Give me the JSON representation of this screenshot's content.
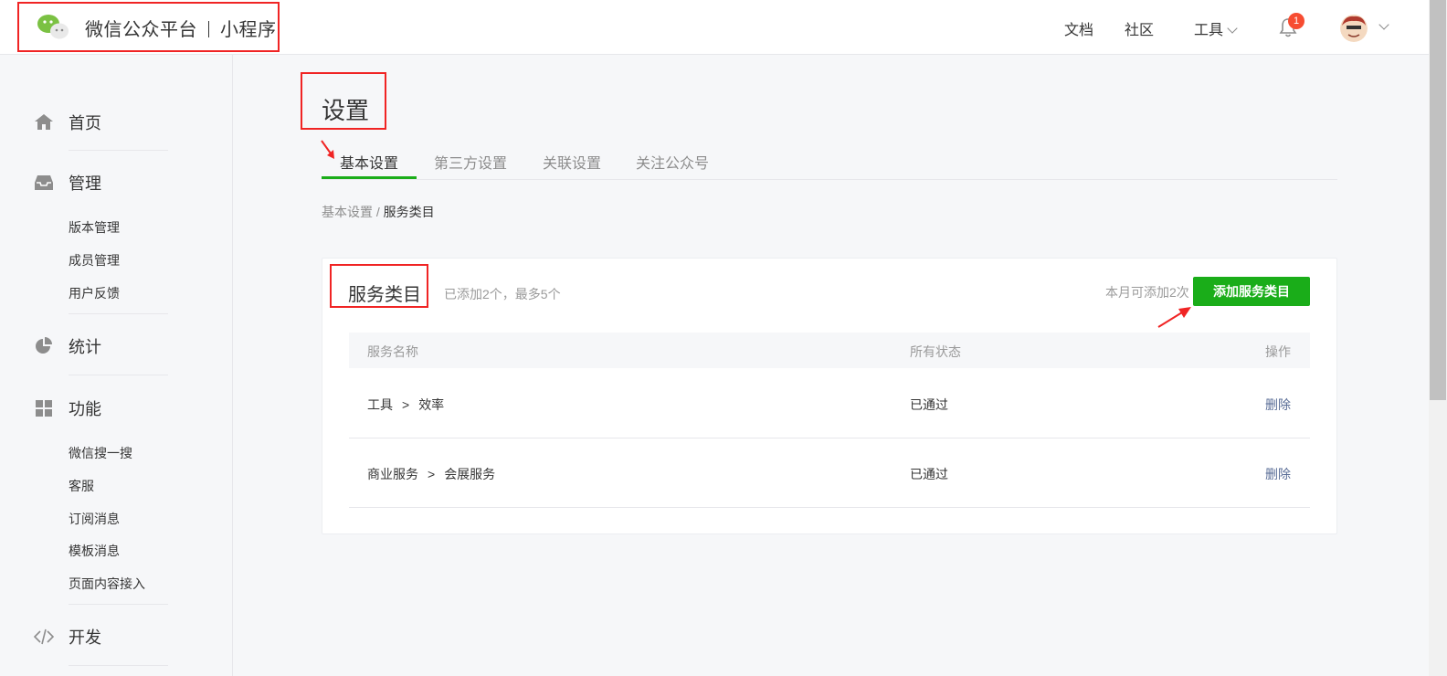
{
  "header": {
    "brand_main": "微信公众平台",
    "brand_sub": "小程序",
    "nav": {
      "docs": "文档",
      "community": "社区",
      "tools": "工具"
    },
    "notification_count": "1"
  },
  "sidebar": {
    "groups": [
      {
        "label": "首页",
        "icon": "home-icon"
      },
      {
        "label": "管理",
        "icon": "inbox-icon",
        "items": [
          "版本管理",
          "成员管理",
          "用户反馈"
        ]
      },
      {
        "label": "统计",
        "icon": "pie-chart-icon"
      },
      {
        "label": "功能",
        "icon": "grid-icon",
        "items": [
          "微信搜一搜",
          "客服",
          "订阅消息",
          "模板消息",
          "页面内容接入"
        ]
      },
      {
        "label": "开发",
        "icon": "code-icon"
      }
    ]
  },
  "main": {
    "page_title": "设置",
    "tabs": [
      "基本设置",
      "第三方设置",
      "关联设置",
      "关注公众号"
    ],
    "breadcrumb": {
      "parent": "基本设置",
      "sep": " / ",
      "current": "服务类目"
    },
    "card": {
      "title": "服务类目",
      "subtitle": "已添加2个，最多5个",
      "quota": "本月可添加2次",
      "add_button": "添加服务类目"
    },
    "table": {
      "columns": [
        "服务名称",
        "所有状态",
        "操作"
      ],
      "rows": [
        {
          "category": "工具",
          "sub": "效率",
          "status": "已通过",
          "action": "删除"
        },
        {
          "category": "商业服务",
          "sub": "会展服务",
          "status": "已通过",
          "action": "删除"
        }
      ],
      "separator": ">"
    }
  },
  "colors": {
    "accent": "#1aad19",
    "link": "#576b95",
    "highlight": "#f02424"
  }
}
